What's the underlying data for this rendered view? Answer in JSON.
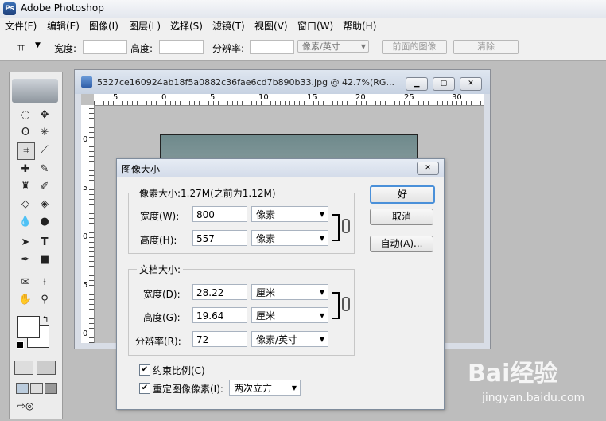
{
  "app": {
    "title": "Adobe Photoshop",
    "icon_text": "Ps"
  },
  "menu": [
    "文件(F)",
    "编辑(E)",
    "图像(I)",
    "图层(L)",
    "选择(S)",
    "滤镜(T)",
    "视图(V)",
    "窗口(W)",
    "帮助(H)"
  ],
  "options": {
    "width_label": "宽度:",
    "height_label": "高度:",
    "resolution_label": "分辨率:",
    "unit_value": "像素/英寸",
    "front_image_button": "前面的图像",
    "clear_button": "清除"
  },
  "document": {
    "title": "5327ce160924ab18f5a0882c36fae6cd7b890b33.jpg @ 42.7%(RG...",
    "ruler_h_labels": [
      "5",
      "0",
      "5",
      "10",
      "15",
      "20",
      "25",
      "30"
    ],
    "ruler_v_labels": [
      "0",
      "5",
      "0",
      "5",
      "0"
    ]
  },
  "dialog": {
    "title": "图像大小",
    "pixel_group_label": "像素大小:1.27M(之前为1.12M)",
    "width_label": "宽度(W):",
    "width_value": "800",
    "width_unit": "像素",
    "height_label": "高度(H):",
    "height_value": "557",
    "height_unit": "像素",
    "doc_group_label": "文档大小:",
    "doc_width_label": "宽度(D):",
    "doc_width_value": "28.22",
    "doc_width_unit": "厘米",
    "doc_height_label": "高度(G):",
    "doc_height_value": "19.64",
    "doc_height_unit": "厘米",
    "resolution_label": "分辨率(R):",
    "resolution_value": "72",
    "resolution_unit": "像素/英寸",
    "ok_button": "好",
    "cancel_button": "取消",
    "auto_button": "自动(A)...",
    "constrain_label": "约束比例(C)",
    "resample_label": "重定图像像素(I):",
    "resample_method": "两次立方"
  },
  "watermark": {
    "brand": "Bai经验",
    "url": "jingyan.baidu.com"
  }
}
